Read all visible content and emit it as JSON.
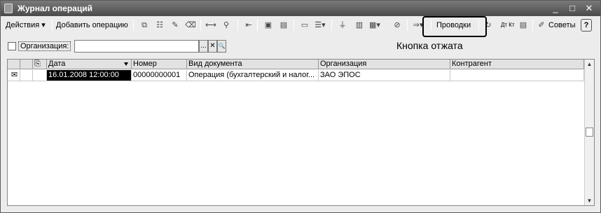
{
  "window": {
    "title": "Журнал операций",
    "controls": {
      "minimize": "_",
      "maximize": "□",
      "close": "✕"
    }
  },
  "toolbar": {
    "actions_label": "Действия ▾",
    "add_operation_label": "Добавить операцию",
    "entries_label": "Проводки",
    "dt_kt_label": "Дт Кт",
    "tips_label": "Советы",
    "help_label": "?"
  },
  "filter": {
    "organization_label": "Организация:",
    "organization_value": "",
    "select_label": "...",
    "clear_label": "✕",
    "search_label": "🔍"
  },
  "annotation": {
    "text": "Кнопка отжата"
  },
  "table": {
    "columns": [
      "Дата",
      "Номер",
      "Вид документа",
      "Организация",
      "Контрагент"
    ],
    "rows": [
      {
        "date": "16.01.2008 12:00:00",
        "number": "00000000001",
        "doc_type": "Операция (бухгалтерский и налог...",
        "organization": "ЗАО ЭПОС",
        "counterparty": ""
      }
    ]
  }
}
